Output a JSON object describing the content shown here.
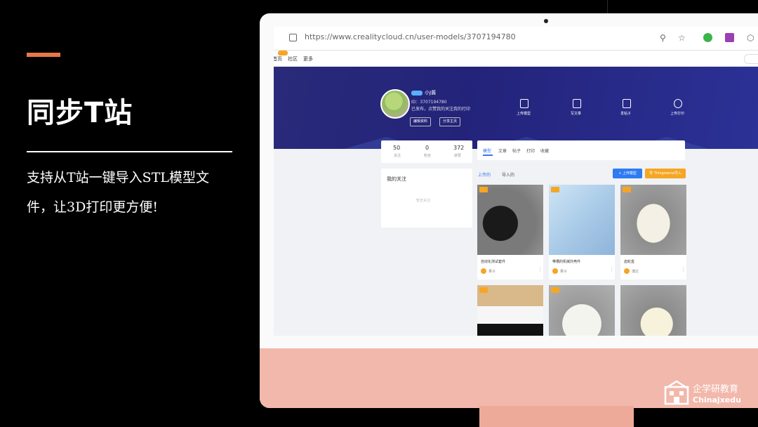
{
  "slide": {
    "title": "同步T站",
    "description": "支持从T站一键导入STL模型文件，让3D打印更方便!",
    "accent_color": "#e8774a"
  },
  "browser": {
    "url": "https://www.crealitycloud.cn/user-models/3707194780"
  },
  "site": {
    "nav": [
      "首页",
      "社区",
      "更多"
    ],
    "profile": {
      "name": "小J酱",
      "id": "ID：3707194780",
      "bio": "已发布，点赞我的关注我的打印",
      "edit_button": "编辑资料",
      "share_button": "分享主页"
    },
    "stats_icons": [
      {
        "label": "上传模型",
        "icon": "model-icon"
      },
      {
        "label": "写文章",
        "icon": "article-icon"
      },
      {
        "label": "发帖子",
        "icon": "post-icon"
      },
      {
        "label": "上传打印",
        "icon": "print-icon"
      }
    ],
    "counters": [
      {
        "value": "50",
        "label": "关注"
      },
      {
        "value": "0",
        "label": "粉丝"
      },
      {
        "value": "372",
        "label": "获赞"
      }
    ],
    "follow_panel": {
      "title": "我的关注",
      "empty": "暂无关注"
    },
    "tabs": [
      "模型",
      "文章",
      "帖子",
      "打印",
      "收藏"
    ],
    "sub_tabs": [
      "上传的",
      "导入的"
    ],
    "upload_button": "+ 上传模型",
    "import_button": "导 Thingiverse导入",
    "cards": [
      {
        "title": "自动化测试套件",
        "author": "果子"
      },
      {
        "title": "带槽的机械外壳件",
        "author": "果子"
      },
      {
        "title": "齿轮盒",
        "author": "博达"
      },
      {
        "title": "",
        "author": ""
      },
      {
        "title": "",
        "author": ""
      },
      {
        "title": "",
        "author": ""
      }
    ]
  },
  "brand": {
    "name_cn": "企学研教育",
    "name_en": "Chinajxedu"
  }
}
